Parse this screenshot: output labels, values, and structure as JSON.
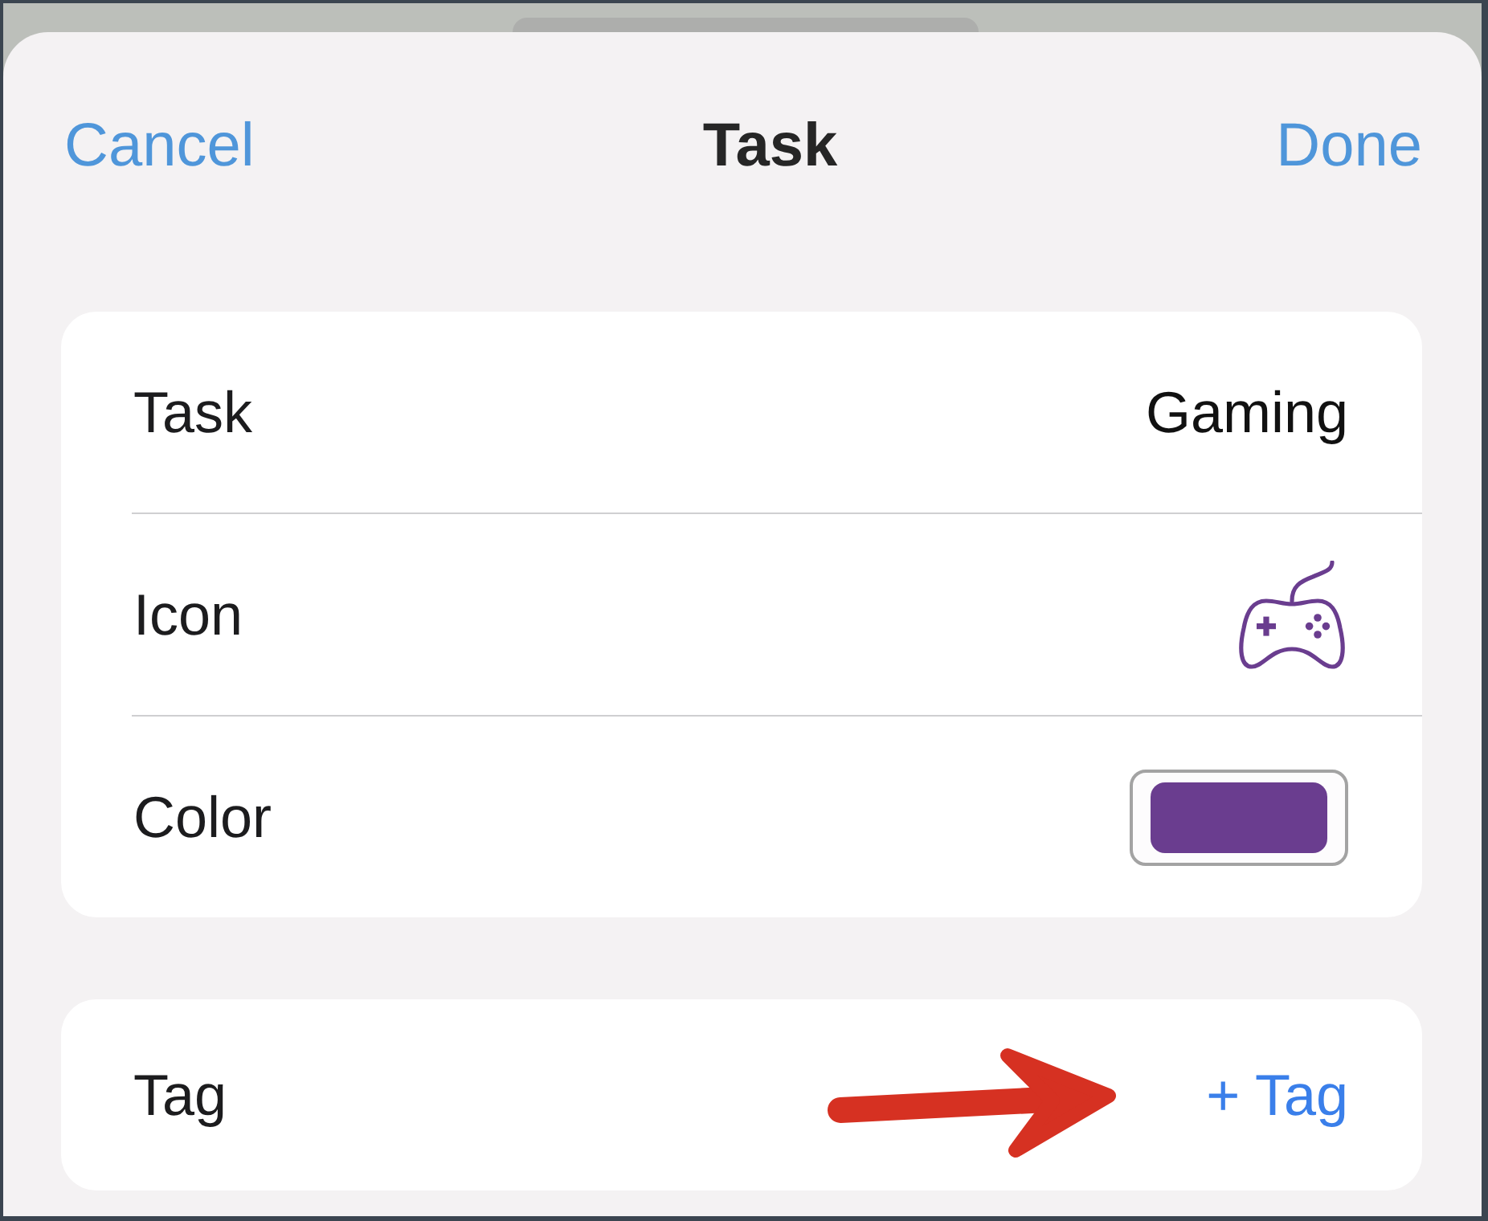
{
  "nav": {
    "cancel": "Cancel",
    "title": "Task",
    "done": "Done"
  },
  "details": [
    {
      "kind": "text",
      "label": "Task",
      "value": "Gaming"
    },
    {
      "kind": "icon",
      "label": "Icon"
    },
    {
      "kind": "color",
      "label": "Color",
      "color": "#6a3d8f"
    }
  ],
  "tag": {
    "label": "Tag",
    "button": "+ Tag",
    "arrow": true
  }
}
